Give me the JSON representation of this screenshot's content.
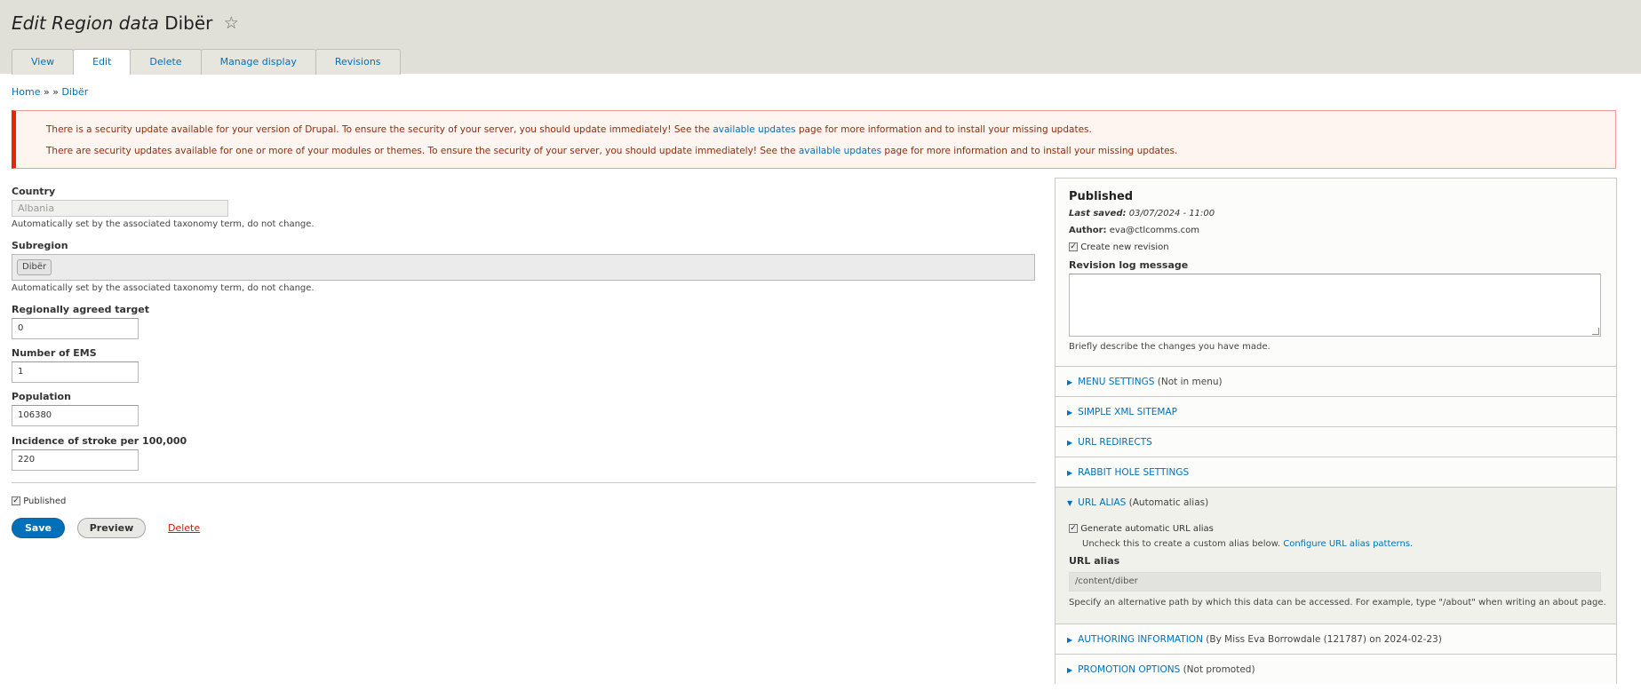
{
  "header": {
    "title_prefix": "Edit Region data",
    "title_name": "Dibër",
    "tabs": [
      {
        "label": "View"
      },
      {
        "label": "Edit"
      },
      {
        "label": "Delete"
      },
      {
        "label": "Manage display"
      },
      {
        "label": "Revisions"
      }
    ]
  },
  "breadcrumb": {
    "home": "Home",
    "sep1": "»",
    "sep2": "»",
    "current": "Dibër"
  },
  "messages": {
    "msg1_pre": "There is a security update available for your version of Drupal. To ensure the security of your server, you should update immediately! See the",
    "msg1_link": "available updates",
    "msg1_post": "page for more information and to install your missing updates.",
    "msg2_pre": "There are security updates available for one or more of your modules or themes. To ensure the security of your server, you should update immediately! See the",
    "msg2_link": "available updates",
    "msg2_post": "page for more information and to install your missing updates."
  },
  "form": {
    "country_label": "Country",
    "country_value": "Albania",
    "country_desc": "Automatically set by the associated taxonomy term, do not change.",
    "subregion_label": "Subregion",
    "subregion_chip": "Dibër",
    "subregion_desc": "Automatically set by the associated taxonomy term, do not change.",
    "target_label": "Regionally agreed target",
    "target_value": "0",
    "ems_label": "Number of EMS",
    "ems_value": "1",
    "population_label": "Population",
    "population_value": "106380",
    "incidence_label": "Incidence of stroke per 100,000",
    "incidence_value": "220",
    "published_label": "Published",
    "save_label": "Save",
    "preview_label": "Preview",
    "delete_label": "Delete"
  },
  "sidebar": {
    "status": "Published",
    "last_saved_label": "Last saved:",
    "last_saved_value": "03/07/2024 - 11:00",
    "author_label": "Author:",
    "author_value": "eva@ctlcomms.com",
    "create_revision": "Create new revision",
    "revision_log_label": "Revision log message",
    "revision_log_desc": "Briefly describe the changes you have made.",
    "sections": [
      {
        "title": "Menu settings",
        "note": "(Not in menu)"
      },
      {
        "title": "Simple XML Sitemap",
        "note": ""
      },
      {
        "title": "URL redirects",
        "note": ""
      },
      {
        "title": "Rabbit hole settings",
        "note": ""
      },
      {
        "title": "URL alias",
        "note": "(Automatic alias)"
      },
      {
        "title": "Authoring information",
        "note": "(By Miss Eva Borrowdale (121787) on 2024-02-23)"
      },
      {
        "title": "Promotion options",
        "note": "(Not promoted)"
      }
    ],
    "url_alias": {
      "generate_label": "Generate automatic URL alias",
      "uncheck_desc": "Uncheck this to create a custom alias below.",
      "configure_link": "Configure URL alias patterns.",
      "alias_label": "URL alias",
      "alias_value": "/content/diber",
      "alias_desc": "Specify an alternative path by which this data can be accessed. For example, type \"/about\" when writing an about page."
    }
  },
  "icons": {
    "star": "☆",
    "collapsed": "▶",
    "expanded": "▼",
    "check": "✓"
  },
  "colors": {
    "link": "#0071b8",
    "error_border": "#e62600",
    "error_text": "#8c2e0b",
    "header_bg": "#e0e0d8"
  }
}
